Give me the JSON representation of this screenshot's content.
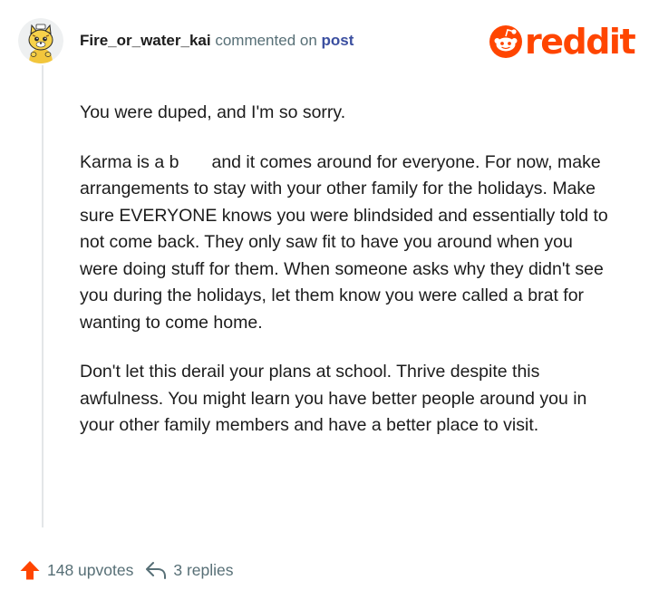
{
  "comment": {
    "username": "Fire_or_water_kai",
    "action_text": "commented on",
    "target_link": "post",
    "paragraphs": [
      {
        "text": "You were duped, and I'm so sorry."
      },
      {
        "before_redaction": "Karma is a b",
        "after_redaction": "and it comes around for everyone. For now, make arrangements to stay with your other family for the holidays. Make sure EVERYONE knows you were blindsided and essentially told to not come back. They only saw fit to have you around when you were doing stuff for them. When someone asks why they didn't see you during the holidays, let them know you were called a brat for wanting to come home."
      },
      {
        "text": "Don't let this derail your plans at school. Thrive despite this awfulness. You might learn you have better people around you in your other family members and have a better place to visit."
      }
    ]
  },
  "brand": {
    "wordmark": "reddit",
    "color": "#ff4500"
  },
  "footer": {
    "upvotes_label": "148 upvotes",
    "replies_label": "3 replies",
    "upvote_color": "#ff4500",
    "muted_color": "#576f76"
  },
  "icons": {
    "avatar": "snoo-avatar-yellow-cat",
    "brand": "reddit-snoo-logo-icon",
    "upvote": "upvote-arrow-icon",
    "reply": "reply-arrow-icon"
  }
}
